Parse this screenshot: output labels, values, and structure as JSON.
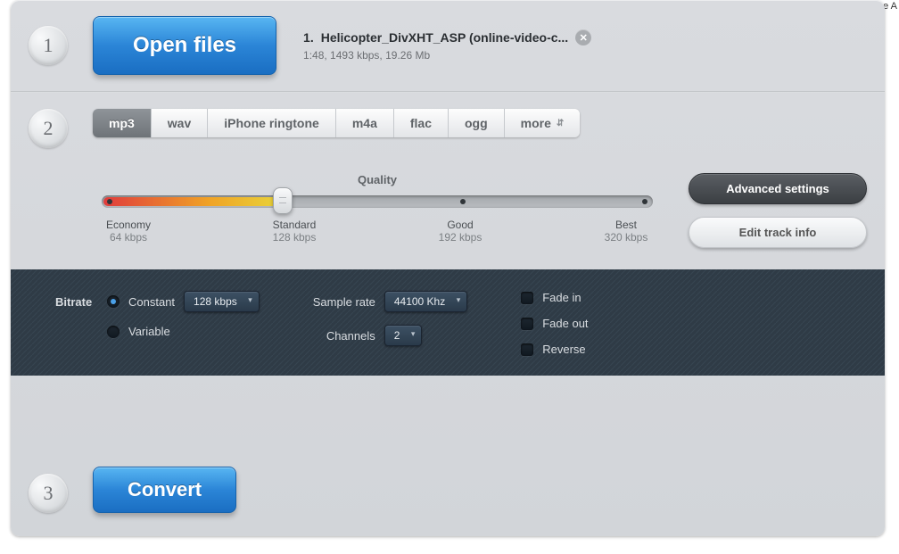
{
  "remove_link": "Remove A",
  "step1": {
    "open_label": "Open files",
    "file": {
      "index": "1.",
      "name": "Helicopter_DivXHT_ASP (online-video-c...",
      "meta": "1:48, 1493 kbps, 19.26 Mb"
    }
  },
  "step2": {
    "tabs": [
      "mp3",
      "wav",
      "iPhone ringtone",
      "m4a",
      "flac",
      "ogg",
      "more"
    ],
    "active_tab": 0,
    "quality_title": "Quality",
    "stops": [
      {
        "name": "Economy",
        "rate": "64 kbps"
      },
      {
        "name": "Standard",
        "rate": "128 kbps"
      },
      {
        "name": "Good",
        "rate": "192 kbps"
      },
      {
        "name": "Best",
        "rate": "320 kbps"
      }
    ],
    "advanced_btn": "Advanced settings",
    "edit_btn": "Edit track info"
  },
  "adv": {
    "bitrate_label": "Bitrate",
    "bitrate_mode": {
      "constant": "Constant",
      "variable": "Variable"
    },
    "bitrate_value": "128 kbps",
    "samplerate_label": "Sample rate",
    "samplerate_value": "44100 Khz",
    "channels_label": "Channels",
    "channels_value": "2",
    "fade_in": "Fade in",
    "fade_out": "Fade out",
    "reverse": "Reverse"
  },
  "step3": {
    "convert_label": "Convert"
  },
  "step_numbers": {
    "one": "1",
    "two": "2",
    "three": "3"
  }
}
